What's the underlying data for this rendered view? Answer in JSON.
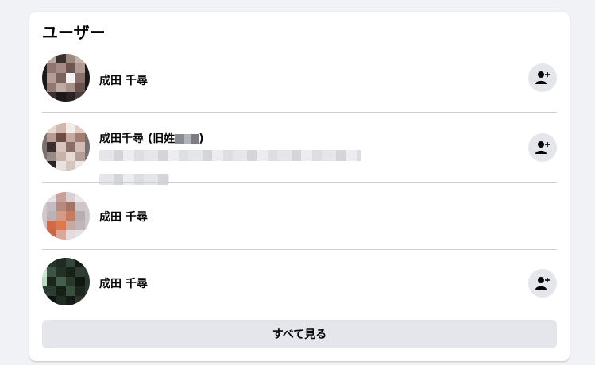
{
  "section": {
    "title": "ユーザー"
  },
  "users": [
    {
      "name": "成田 千尋",
      "has_add_friend": true
    },
    {
      "name_prefix": "成田千尋 (旧姓",
      "name_suffix": ")",
      "has_add_friend": true
    },
    {
      "name": "成田 千尋",
      "has_add_friend": false
    },
    {
      "name": "成田 千尋",
      "has_add_friend": true
    }
  ],
  "footer": {
    "see_all_label": "すべて見る"
  },
  "icons": {
    "add_friend": "person-add-icon"
  },
  "colors": {
    "button_bg": "#e4e6eb",
    "divider": "#ced0d4",
    "page_bg": "#f0f2f5"
  }
}
